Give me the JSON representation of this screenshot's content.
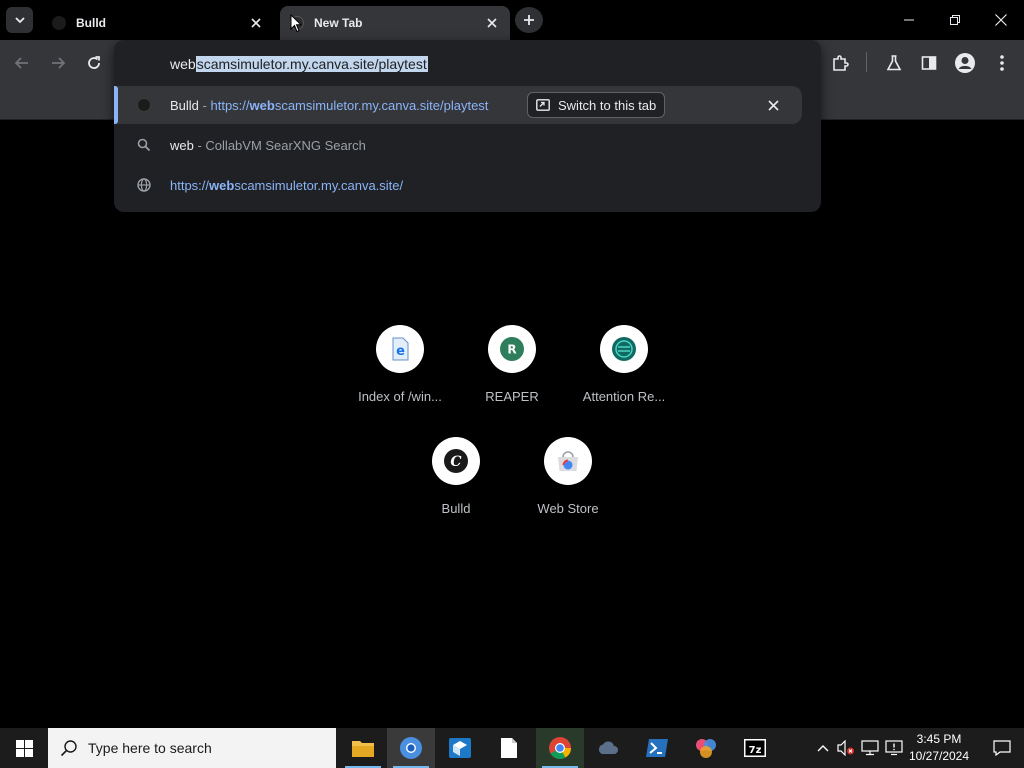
{
  "tabs": [
    {
      "title": "Bulld",
      "active": false
    },
    {
      "title": "New Tab",
      "active": true
    }
  ],
  "omnibox": {
    "typed": "web",
    "autocomplete_selected": "scamsimuletor.my.canva.site/playtest",
    "suggestions": [
      {
        "title": "Bulld",
        "separator": " - ",
        "url_prefix": "https://",
        "url_match": "web",
        "url_rest": "scamsimuletor.my.canva.site/playtest",
        "action_label": "Switch to this tab"
      },
      {
        "query": "web",
        "separator": " - ",
        "engine": "CollabVM SearXNG Search"
      },
      {
        "url_prefix": "https://",
        "url_match": "web",
        "url_rest": "scamsimuletor.my.canva.site/"
      }
    ]
  },
  "shortcuts": [
    {
      "label": "Index of /win...",
      "icon": "ie-document-icon"
    },
    {
      "label": "REAPER",
      "icon": "reaper-icon",
      "letter": "R"
    },
    {
      "label": "Attention Re...",
      "icon": "attention-icon"
    },
    {
      "label": "Bulld",
      "icon": "bulld-icon",
      "letter": "C"
    },
    {
      "label": "Web Store",
      "icon": "web-store-icon"
    }
  ],
  "taskbar": {
    "search_placeholder": "Type here to search",
    "clock_time": "3:45 PM",
    "clock_date": "10/27/2024"
  },
  "colors": {
    "accent": "#8ab4f8",
    "toolbar_bg": "#35363a",
    "dropdown_bg": "#202124",
    "page_bg": "#000000",
    "taskbar_bg": "#1c1c1c"
  }
}
